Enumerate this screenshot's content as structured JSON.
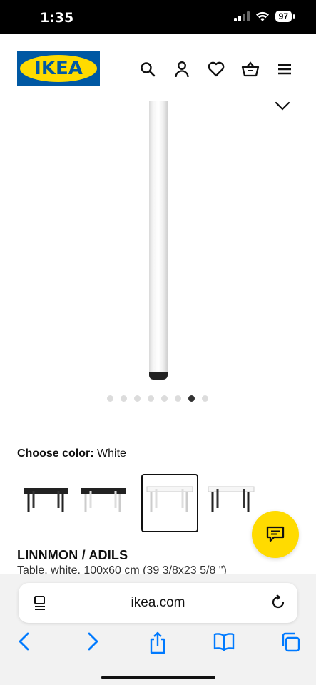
{
  "status": {
    "time": "1:35",
    "battery": "97"
  },
  "header": {
    "logo_text": "IKEA"
  },
  "gallery": {
    "dot_count": 8,
    "active_dot": 6
  },
  "color_chooser": {
    "label": "Choose color:",
    "value": "White"
  },
  "product": {
    "title": "LINNMON / ADILS",
    "subtitle": "Table, white, 100x60 cm (39 3/8x23 5/8 \")"
  },
  "browser": {
    "url": "ikea.com"
  },
  "colors": {
    "ikea_blue": "#0058a3",
    "ikea_yellow": "#ffdb00",
    "ios_blue": "#007aff"
  }
}
